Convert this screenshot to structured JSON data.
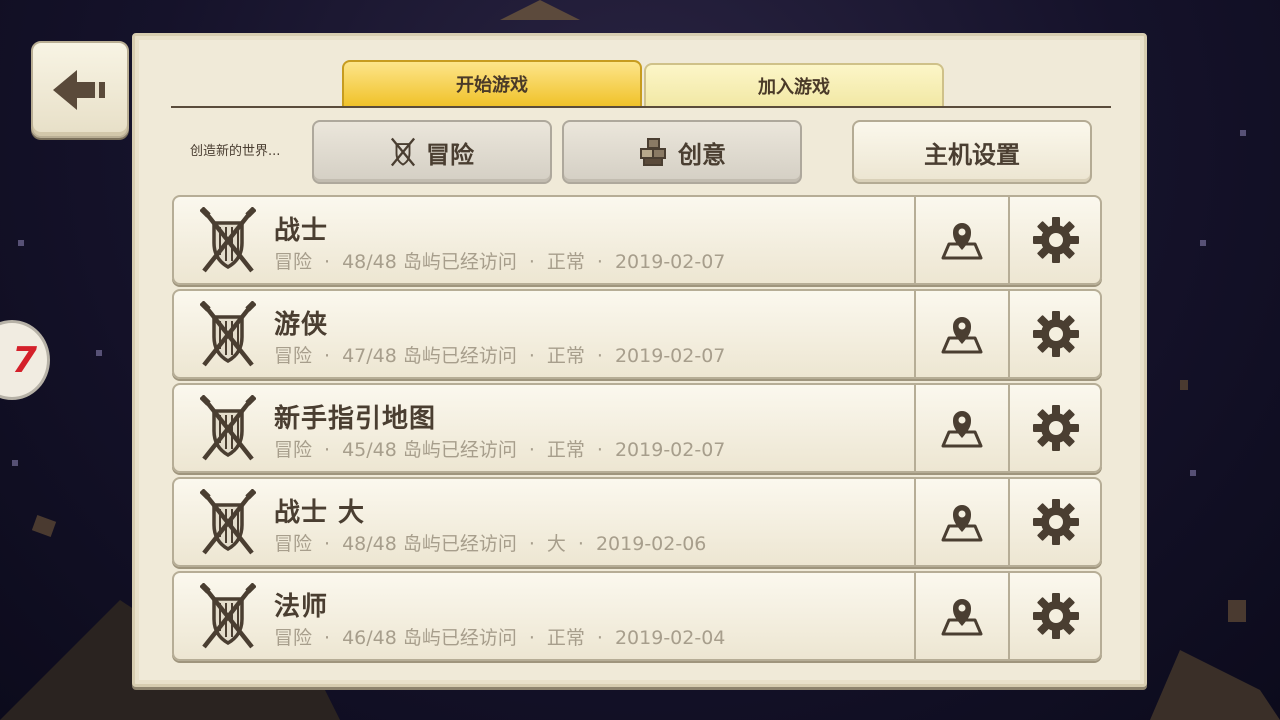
{
  "colors": {
    "panel_bg": "#f0ead8",
    "tab_active": "#f0c22a",
    "tab_inactive": "#f2e8a5",
    "text_dark": "#4a3e31",
    "text_muted": "#a79e8c",
    "icon": "#4a3e31"
  },
  "back_button": {
    "icon": "left-arrow-icon"
  },
  "side_badge": {
    "text": "7"
  },
  "tabs": [
    {
      "label": "开始游戏",
      "active": true
    },
    {
      "label": "加入游戏",
      "active": false
    }
  ],
  "create_label": "创造新的世界...",
  "mode_buttons": {
    "adventure": {
      "label": "冒险",
      "icon": "sword-shield-icon"
    },
    "creative": {
      "label": "创意",
      "icon": "blocks-icon"
    },
    "host_settings": {
      "label": "主机设置"
    }
  },
  "worlds": [
    {
      "name": "战士",
      "mode": "冒险",
      "islands": "48/48 岛屿已经访问",
      "difficulty": "正常",
      "date": "2019-02-07"
    },
    {
      "name": "游侠",
      "mode": "冒险",
      "islands": "47/48 岛屿已经访问",
      "difficulty": "正常",
      "date": "2019-02-07"
    },
    {
      "name": "新手指引地图",
      "mode": "冒险",
      "islands": "45/48 岛屿已经访问",
      "difficulty": "正常",
      "date": "2019-02-07"
    },
    {
      "name": "战士 大",
      "mode": "冒险",
      "islands": "48/48 岛屿已经访问",
      "difficulty": "大",
      "date": "2019-02-06"
    },
    {
      "name": "法师",
      "mode": "冒险",
      "islands": "46/48 岛屿已经访问",
      "difficulty": "正常",
      "date": "2019-02-04"
    }
  ],
  "meta_separator": "·",
  "row_icons": {
    "world": "sword-shield-icon",
    "map": "map-pin-icon",
    "settings": "gear-icon"
  }
}
